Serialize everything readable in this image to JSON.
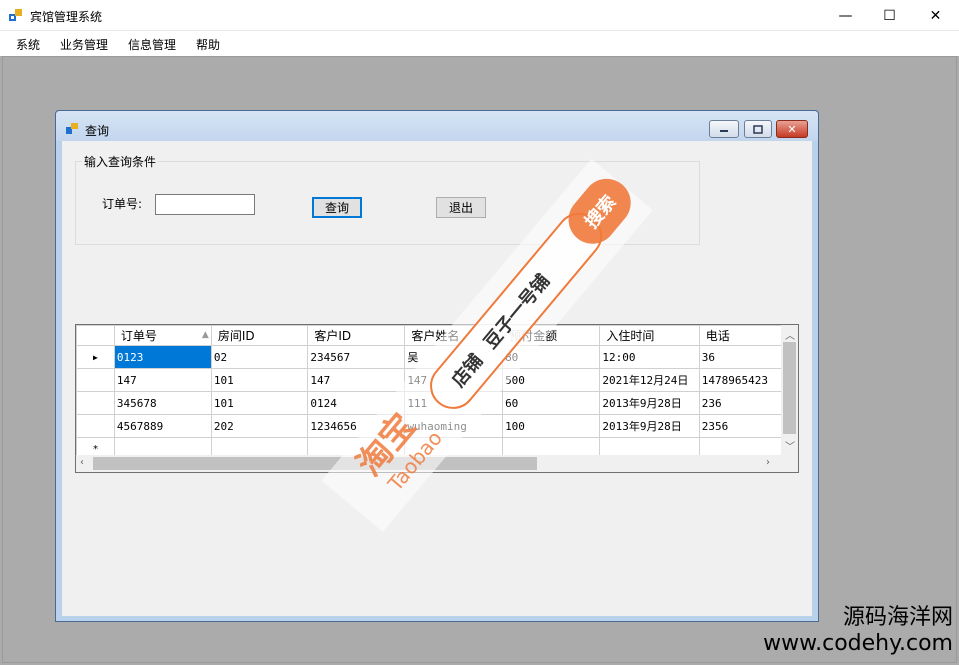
{
  "window": {
    "title": "宾馆管理系统",
    "minimize": "—",
    "maximize": "☐",
    "close": "✕"
  },
  "menu": [
    "系统",
    "业务管理",
    "信息管理",
    "帮助"
  ],
  "child": {
    "title": "查询",
    "group_title": "输入查询条件",
    "order_label": "订单号:",
    "order_value": "",
    "query_button": "查询",
    "exit_button": "退出"
  },
  "grid": {
    "columns": [
      "订单号",
      "房间ID",
      "客户ID",
      "客户姓名",
      "预付金额",
      "入住时间",
      "电话"
    ],
    "sort_indicator": "▲",
    "rows": [
      [
        "0123",
        "02",
        "234567",
        "吴",
        "80",
        "12:00",
        "36"
      ],
      [
        "147",
        "101",
        "147",
        "147",
        "500",
        "2021年12月24日",
        "1478965423"
      ],
      [
        "345678",
        "101",
        "0124",
        "111",
        "60",
        "2013年9月28日",
        "236"
      ],
      [
        "4567889",
        "202",
        "1234656",
        "wuhaoming",
        "100",
        "2013年9月28日",
        "2356"
      ]
    ],
    "current_row_marker": "▶",
    "new_row_marker": "*"
  },
  "watermark": {
    "shop_label": "店铺",
    "shop_name": "豆子一号铺",
    "search_badge": "搜索",
    "brand_cn": "淘宝",
    "brand_en": "Taobao",
    "site_cn": "源码海洋网",
    "site_url": "www.codehy.com"
  },
  "colors": {
    "selection": "#0078d7",
    "watermark_orange": "#f07a3c",
    "mdi_background": "#ababab"
  }
}
